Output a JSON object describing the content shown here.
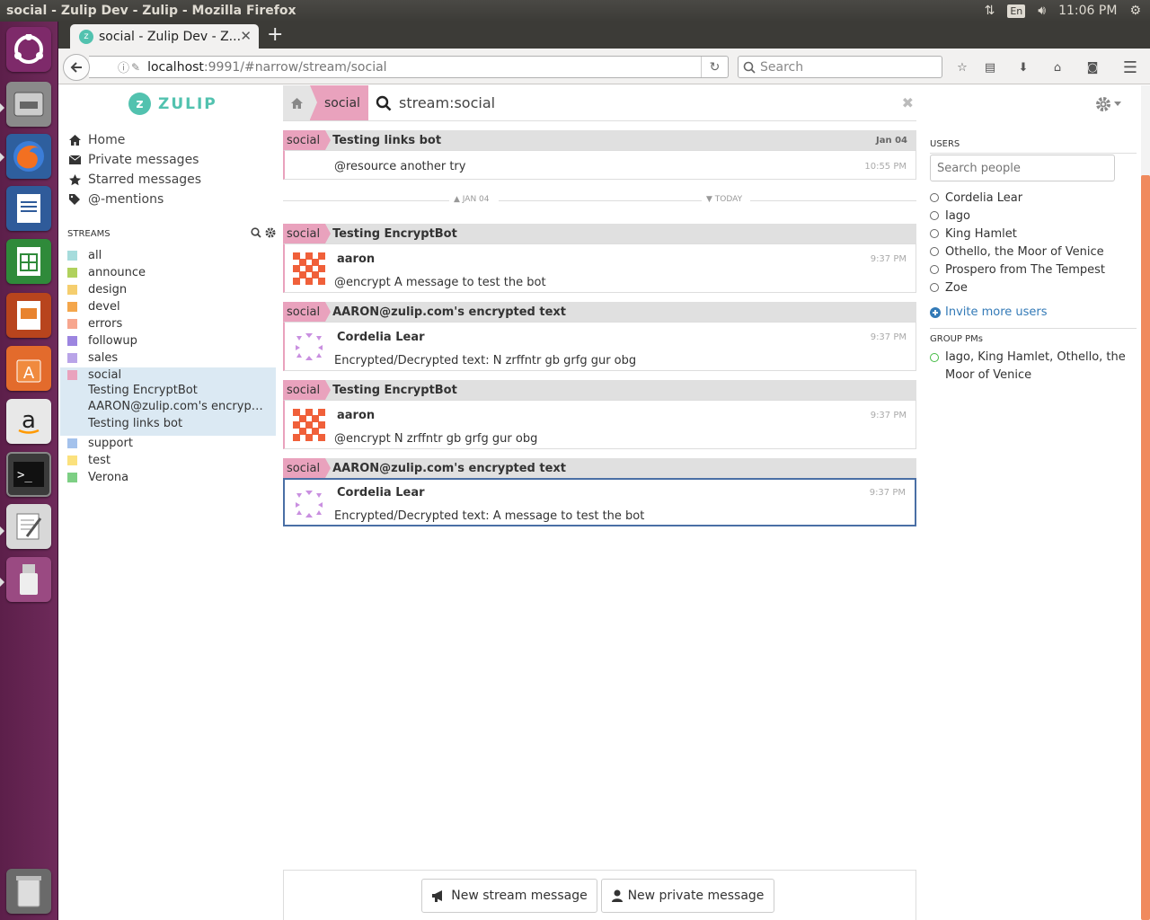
{
  "os": {
    "window_title": "social - Zulip Dev - Zulip - Mozilla Firefox",
    "lang": "En",
    "clock": "11:06 PM"
  },
  "browser": {
    "tab_title": "social - Zulip Dev - Z...",
    "url_host": "localhost",
    "url_rest": ":9991/#narrow/stream/social",
    "search_placeholder": "Search"
  },
  "brand": "ZULIP",
  "nav": [
    {
      "label": "Home",
      "icon": "home-icon"
    },
    {
      "label": "Private messages",
      "icon": "envelope-icon"
    },
    {
      "label": "Starred messages",
      "icon": "star-icon"
    },
    {
      "label": "@-mentions",
      "icon": "tag-icon"
    }
  ],
  "streams_header": "STREAMS",
  "streams": [
    {
      "name": "all",
      "color": "#a6dcdc"
    },
    {
      "name": "announce",
      "color": "#b0d15d"
    },
    {
      "name": "design",
      "color": "#f5ce6e"
    },
    {
      "name": "devel",
      "color": "#f4a64b"
    },
    {
      "name": "errors",
      "color": "#f7a68e"
    },
    {
      "name": "followup",
      "color": "#9c85e0"
    },
    {
      "name": "sales",
      "color": "#b9a4e8"
    },
    {
      "name": "social",
      "color": "#e9a2bd"
    },
    {
      "name": "support",
      "color": "#a4c2ec"
    },
    {
      "name": "test",
      "color": "#fbe17d"
    },
    {
      "name": "Verona",
      "color": "#7dcf84"
    }
  ],
  "social_topics": [
    "Testing EncryptBot",
    "AARON@zulip.com's encrypted text",
    "Testing links bot"
  ],
  "narrow": {
    "stream": "social",
    "search": "stream:social"
  },
  "day_dividers": {
    "left": "JAN 04",
    "right": "TODAY"
  },
  "messages": [
    {
      "stream": "social",
      "topic": "Testing links bot",
      "date": "Jan 04",
      "sender": "",
      "text": "@resource another try",
      "time": "10:55 PM"
    },
    {
      "stream": "social",
      "topic": "Testing EncryptBot",
      "date": "",
      "sender": "aaron",
      "text": "@encrypt A message to test the bot",
      "time": "9:37 PM"
    },
    {
      "stream": "social",
      "topic": "AARON@zulip.com's encrypted text",
      "date": "",
      "sender": "Cordelia Lear",
      "text": "Encrypted/Decrypted text: N zrffntr gb grfg gur obg",
      "time": "9:37 PM"
    },
    {
      "stream": "social",
      "topic": "Testing EncryptBot",
      "date": "",
      "sender": "aaron",
      "text": "@encrypt N zrffntr gb grfg gur obg",
      "time": "9:37 PM"
    },
    {
      "stream": "social",
      "topic": "AARON@zulip.com's encrypted text",
      "date": "",
      "sender": "Cordelia Lear",
      "text": "Encrypted/Decrypted text: A message to test the bot",
      "time": "9:37 PM"
    }
  ],
  "compose": {
    "new_stream": "New stream message",
    "new_private": "New private message"
  },
  "users_header": "USERS",
  "search_people_placeholder": "Search people",
  "users": [
    "Cordelia Lear",
    "Iago",
    "King Hamlet",
    "Othello, the Moor of Venice",
    "Prospero from The Tempest",
    "Zoe"
  ],
  "invite": "Invite more users",
  "group_pms_header": "GROUP PMs",
  "group_pm": "Iago, King Hamlet, Othello, the Moor of Venice"
}
